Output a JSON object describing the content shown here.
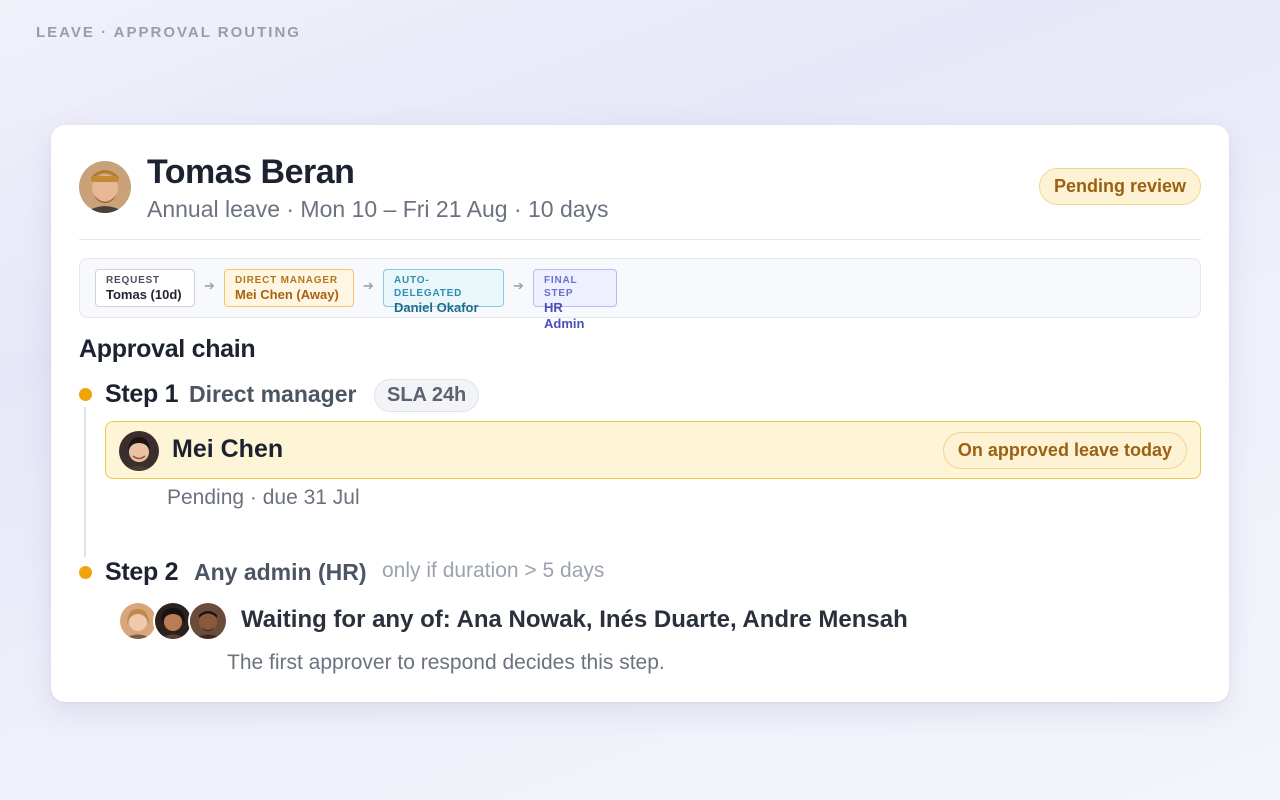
{
  "breadcrumb": "LEAVE · APPROVAL ROUTING",
  "request": {
    "employee_name": "Tomas Beran",
    "summary": "Annual leave · Mon 10 – Fri 21 Aug · 10 days",
    "status": "Pending review"
  },
  "routing": [
    {
      "label": "REQUEST",
      "value": "Tomas (10d)"
    },
    {
      "label": "DIRECT MANAGER",
      "value": "Mei Chen (Away)"
    },
    {
      "label": "AUTO-DELEGATED",
      "value": "Daniel Okafor"
    },
    {
      "label": "FINAL STEP",
      "value": "HR Admin"
    }
  ],
  "chain": {
    "title": "Approval chain",
    "step1": {
      "label": "Step 1",
      "role": "Direct manager",
      "sla": "SLA 24h",
      "approver": "Mei Chen",
      "approver_badge": "On approved leave today",
      "status": "Pending · due 31 Jul"
    },
    "step2": {
      "label": "Step 2",
      "role": "Any admin (HR)",
      "condition": "only if duration > 5 days",
      "waiting": "Waiting for any of: Ana Nowak, Inés Duarte, Andre Mensah",
      "note": "The first approver to respond decides this step."
    }
  },
  "colors": {
    "accent_dot": "#f2a20c",
    "pending_bg": "#fdf2d4",
    "pending_text": "#9a6112"
  },
  "icons": [
    "arrow-right-icon",
    "avatar"
  ]
}
